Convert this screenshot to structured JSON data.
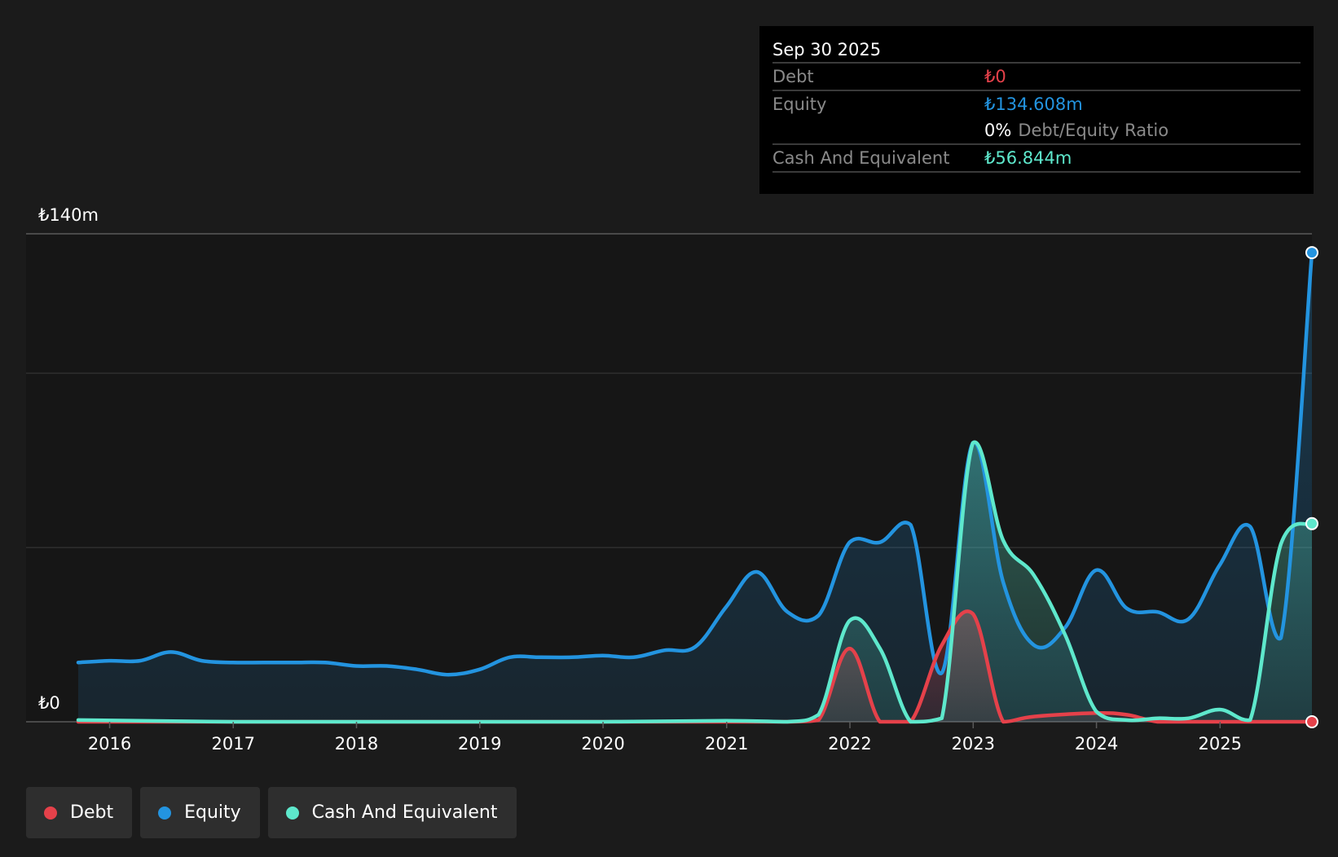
{
  "tooltip": {
    "date": "Sep 30 2025",
    "rows": [
      {
        "label": "Debt",
        "value": "₺0"
      },
      {
        "label": "Equity",
        "value": "₺134.608m"
      },
      {
        "label": "",
        "value": "0%",
        "extra": "Debt/Equity Ratio"
      },
      {
        "label": "Cash And Equivalent",
        "value": "₺56.844m"
      }
    ]
  },
  "legend": [
    {
      "label": "Debt",
      "color": "#e5414a"
    },
    {
      "label": "Equity",
      "color": "#2394e0"
    },
    {
      "label": "Cash And Equivalent",
      "color": "#5ee8cc"
    }
  ],
  "chart_data": {
    "type": "area",
    "currency": "₺",
    "y_tick_labels": [
      "₺0",
      "₺140m"
    ],
    "ylim": [
      0,
      140
    ],
    "y_unit": "₺m",
    "gridlines": [
      0,
      50,
      100,
      140
    ],
    "x_tick_labels": [
      "2016",
      "2017",
      "2018",
      "2019",
      "2020",
      "2021",
      "2022",
      "2023",
      "2024",
      "2025"
    ],
    "xlim": [
      "2015-09-30",
      "2025-09-30"
    ],
    "legend_placement": "bottom-left",
    "series": [
      {
        "name": "Debt",
        "color": "#e5414a",
        "points": [
          [
            "2015-09-30",
            0
          ],
          [
            "2016-12-31",
            0
          ],
          [
            "2018-12-31",
            0
          ],
          [
            "2020-12-31",
            0
          ],
          [
            "2021-06-30",
            0
          ],
          [
            "2021-09-30",
            0.5
          ],
          [
            "2021-12-31",
            21
          ],
          [
            "2022-03-31",
            0
          ],
          [
            "2022-06-30",
            0
          ],
          [
            "2022-09-30",
            22
          ],
          [
            "2022-12-31",
            31
          ],
          [
            "2023-03-31",
            0
          ],
          [
            "2023-06-30",
            1.5
          ],
          [
            "2023-12-31",
            2.5
          ],
          [
            "2024-03-31",
            2
          ],
          [
            "2024-06-30",
            0
          ],
          [
            "2024-09-30",
            0
          ],
          [
            "2024-12-31",
            0
          ],
          [
            "2025-03-31",
            0
          ],
          [
            "2025-06-30",
            0
          ],
          [
            "2025-09-30",
            0
          ]
        ]
      },
      {
        "name": "Equity",
        "color": "#2394e0",
        "points": [
          [
            "2015-09-30",
            17
          ],
          [
            "2015-12-31",
            17.5
          ],
          [
            "2016-03-31",
            17.5
          ],
          [
            "2016-06-30",
            20
          ],
          [
            "2016-09-30",
            17.5
          ],
          [
            "2016-12-31",
            17
          ],
          [
            "2017-03-31",
            17
          ],
          [
            "2017-06-30",
            17
          ],
          [
            "2017-09-30",
            17
          ],
          [
            "2017-12-31",
            16
          ],
          [
            "2018-03-31",
            16
          ],
          [
            "2018-06-30",
            15
          ],
          [
            "2018-09-30",
            13.5
          ],
          [
            "2018-12-31",
            15
          ],
          [
            "2019-03-31",
            18.5
          ],
          [
            "2019-06-30",
            18.5
          ],
          [
            "2019-09-30",
            18.5
          ],
          [
            "2019-12-31",
            19
          ],
          [
            "2020-03-31",
            18.5
          ],
          [
            "2020-06-30",
            20.5
          ],
          [
            "2020-09-30",
            21.5
          ],
          [
            "2020-12-31",
            33
          ],
          [
            "2021-03-31",
            43
          ],
          [
            "2021-06-30",
            31.5
          ],
          [
            "2021-09-30",
            30.5
          ],
          [
            "2021-12-31",
            51.5
          ],
          [
            "2022-03-31",
            51.5
          ],
          [
            "2022-06-30",
            56.5
          ],
          [
            "2022-09-30",
            14
          ],
          [
            "2022-12-31",
            80
          ],
          [
            "2023-03-31",
            40
          ],
          [
            "2023-06-30",
            22
          ],
          [
            "2023-09-30",
            27
          ],
          [
            "2023-12-31",
            43.5
          ],
          [
            "2024-03-31",
            32.5
          ],
          [
            "2024-06-30",
            31.5
          ],
          [
            "2024-09-30",
            29.5
          ],
          [
            "2024-12-31",
            45
          ],
          [
            "2025-03-31",
            56
          ],
          [
            "2025-06-30",
            24
          ],
          [
            "2025-09-30",
            134.608
          ]
        ]
      },
      {
        "name": "Cash And Equivalent",
        "color": "#5ee8cc",
        "points": [
          [
            "2015-09-30",
            0.5
          ],
          [
            "2016-12-31",
            0
          ],
          [
            "2017-12-31",
            0
          ],
          [
            "2018-12-31",
            0
          ],
          [
            "2019-12-31",
            0
          ],
          [
            "2020-12-31",
            0.3
          ],
          [
            "2021-06-30",
            0
          ],
          [
            "2021-09-30",
            2
          ],
          [
            "2021-12-31",
            29
          ],
          [
            "2022-03-31",
            21
          ],
          [
            "2022-06-30",
            0
          ],
          [
            "2022-09-30",
            1
          ],
          [
            "2022-12-31",
            80
          ],
          [
            "2023-03-31",
            52
          ],
          [
            "2023-06-30",
            42
          ],
          [
            "2023-09-30",
            25
          ],
          [
            "2023-12-31",
            3
          ],
          [
            "2024-03-31",
            0.5
          ],
          [
            "2024-06-30",
            1
          ],
          [
            "2024-09-30",
            1
          ],
          [
            "2024-12-31",
            3.5
          ],
          [
            "2025-03-31",
            0.5
          ],
          [
            "2025-06-30",
            51
          ],
          [
            "2025-09-30",
            56.844
          ]
        ]
      }
    ]
  }
}
